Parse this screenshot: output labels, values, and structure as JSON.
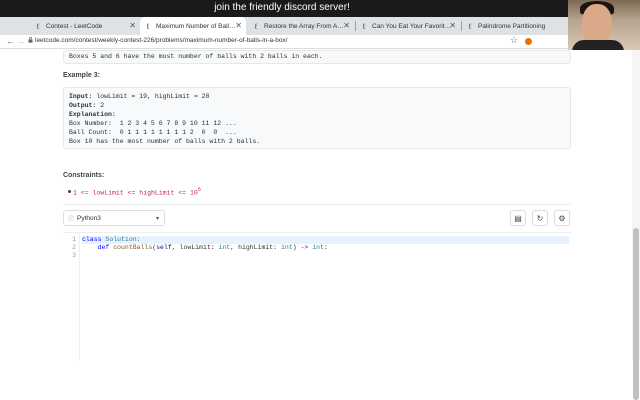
{
  "banner": {
    "text": "join the friendly discord server!"
  },
  "browser": {
    "tabs": [
      {
        "label": "Contest - LeetCode",
        "active": false
      },
      {
        "label": "Maximum Number of Balls in a...",
        "active": true
      },
      {
        "label": "Restore the Array From Adjac...",
        "active": false
      },
      {
        "label": "Can You Eat Your Favorite Can...",
        "active": false
      },
      {
        "label": "Palindrome Partitioning",
        "active": false
      }
    ],
    "new_tab": "+",
    "url": "leetcode.com/contest/weekly-contest-226/problems/maximum-number-of-balls-in-a-box/"
  },
  "problem": {
    "example2_tail": "Boxes 5 and 6 have the most number of balls with 2 balls in each.",
    "example3_heading": "Example 3:",
    "example3_lines": [
      "Input: lowLimit = 19, highLimit = 28",
      "Output: 2",
      "Explanation:",
      "Box Number:  1 2 3 4 5 6 7 8 9 10 11 12 ...",
      "Ball Count:  0 1 1 1 1 1 1 1 1 2  0  0  ...",
      "Box 10 has the most number of balls with 2 balls."
    ],
    "constraints_heading": "Constraints:",
    "constraint_text": "1 <= lowLimit <= highLimit <= 10",
    "constraint_exp": "5"
  },
  "editor": {
    "language": "Python3",
    "line_numbers": [
      "1",
      "2",
      "3"
    ],
    "code_line1_kw": "class",
    "code_line1_name": "Solution:",
    "code_line2": {
      "indent": "    ",
      "kw": "def",
      "fn": "countBalls",
      "rest_open": "(",
      "self": "self",
      "p1": ", lowLimit: ",
      "t1": "int",
      "p2": ", highLimit: ",
      "t2": "int",
      "ret": ") -> ",
      "t3": "int",
      "end": ":"
    }
  },
  "colors": {
    "accent": "#1a73e8",
    "keyword": "#0000ff",
    "constraint": "#c7254e"
  }
}
